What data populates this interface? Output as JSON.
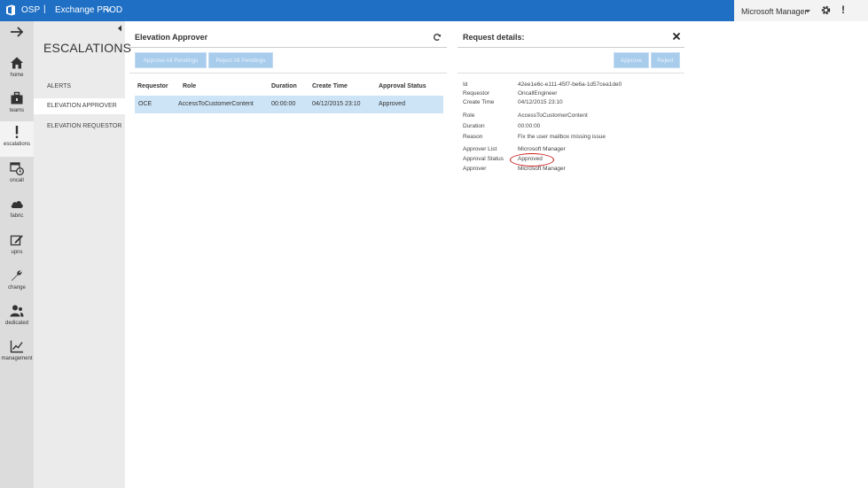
{
  "topbar": {
    "brand": "OSP",
    "separator": "|",
    "environment": "Exchange PROD",
    "user_name": "Microsoft Manager",
    "alert_glyph": "!"
  },
  "icons": {
    "logo": "office-logo-icon",
    "env_dropdown": "chevron-down-icon",
    "user_dropdown": "caret-down-icon",
    "settings": "gear-icon",
    "nav_toggle": "arrow-right-icon",
    "collapse": "chevron-left-icon",
    "refresh": "refresh-icon",
    "close": "close-icon"
  },
  "rail": {
    "items": [
      {
        "label": "home",
        "icon": "home-icon"
      },
      {
        "label": "teams",
        "icon": "briefcase-icon"
      },
      {
        "label": "escalations",
        "icon": "exclamation-icon"
      },
      {
        "label": "oncall",
        "icon": "calendar-clock-icon"
      },
      {
        "label": "fabric",
        "icon": "cloud-icon"
      },
      {
        "label": "upns",
        "icon": "edit-box-icon"
      },
      {
        "label": "change",
        "icon": "wrench-icon"
      },
      {
        "label": "dedicated",
        "icon": "people-icon"
      },
      {
        "label": "management",
        "icon": "chart-icon"
      }
    ]
  },
  "subnav": {
    "title": "ESCALATIONS",
    "items": [
      "ALERTS",
      "ELEVATION APPROVER",
      "ELEVATION REQUESTOR"
    ]
  },
  "main": {
    "title": "Elevation Approver",
    "approve_all_label": "Approve All Pendings",
    "reject_all_label": "Reject All Pendings",
    "columns": [
      "Requestor",
      "Role",
      "Duration",
      "Create Time",
      "Approval Status"
    ],
    "rows": [
      [
        "OCE",
        "AccessToCustomerContent",
        "00:00:00",
        "04/12/2015 23:10",
        "Approved"
      ]
    ]
  },
  "details": {
    "title": "Request details:",
    "approve_label": "Approve",
    "reject_label": "Reject",
    "fields": [
      {
        "label": "Id",
        "value": "42ee1e6c-e111-45f7-be6a-1d57cea1de0"
      },
      {
        "label": "Requestor",
        "value": "OncallEngineer"
      },
      {
        "label": "Create Time",
        "value": "04/12/2015 23:10"
      },
      {
        "label": "Role",
        "value": "AccessToCustomerContent"
      },
      {
        "label": "Duration",
        "value": "00:00:00"
      },
      {
        "label": "Reason",
        "value": "Fix the user mailbox missing issue"
      },
      {
        "label": "Approver List",
        "value": "Microsoft Manager"
      },
      {
        "label": "Approval Status",
        "value": "Approved"
      },
      {
        "label": "Approver",
        "value": "Microsoft Manager"
      }
    ]
  },
  "colors": {
    "topbar": "#1f6fc4",
    "selected_row": "#cde4f6",
    "button": "#a8ccec",
    "highlight_circle": "#cc1f1f"
  }
}
